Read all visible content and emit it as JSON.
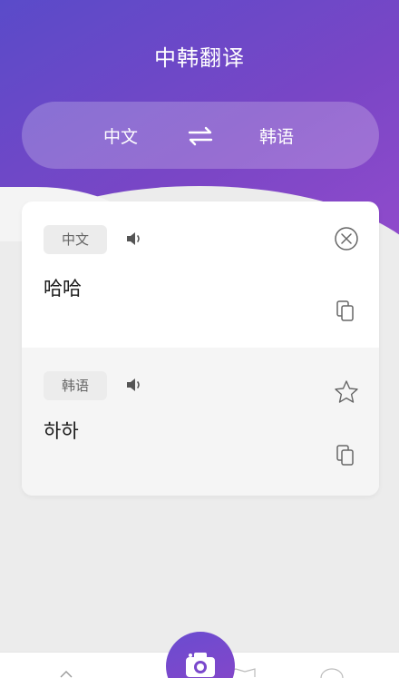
{
  "header": {
    "title": "中韩翻译"
  },
  "language_bar": {
    "source": "中文",
    "target": "韩语",
    "swap_icon": "swap-arrows-icon"
  },
  "source_panel": {
    "language": "中文",
    "text": "哈哈"
  },
  "target_panel": {
    "language": "韩语",
    "text": "하하"
  },
  "icons": {
    "speaker": "speaker-icon",
    "clear": "close-circle-icon",
    "copy": "copy-icon",
    "favorite": "star-icon",
    "camera": "camera-icon"
  },
  "colors": {
    "gradient_start": "#5a4bc9",
    "gradient_end": "#a24fd0",
    "card_bg": "#ffffff",
    "page_bg": "#ececec"
  }
}
